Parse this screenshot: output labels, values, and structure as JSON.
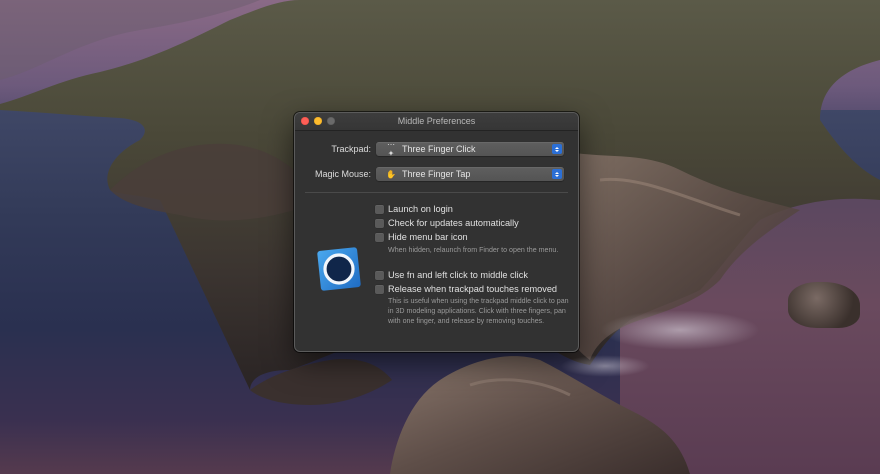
{
  "window": {
    "title": "Middle Preferences"
  },
  "trackpad": {
    "label": "Trackpad:",
    "value": "Three Finger Click",
    "icon": "trackpad-gesture-icon"
  },
  "magic_mouse": {
    "label": "Magic Mouse:",
    "value": "Three Finger Tap",
    "icon": "hand-icon"
  },
  "options": {
    "launch_on_login": "Launch on login",
    "check_updates": "Check for updates automatically",
    "hide_menu_bar_icon": "Hide menu bar icon",
    "hide_menu_bar_help": "When hidden, relaunch from Finder to open the menu.",
    "use_fn": "Use fn and left click to middle click",
    "release_trackpad": "Release when trackpad touches removed",
    "release_help": "This is useful when using the trackpad middle click to pan in 3D modeling applications. Click with three fingers, pan with one finger, and release by removing touches."
  },
  "colors": {
    "accent": "#2b6fd6",
    "close": "#fe5f57",
    "minimize": "#febc2e",
    "window_bg": "#323232"
  }
}
